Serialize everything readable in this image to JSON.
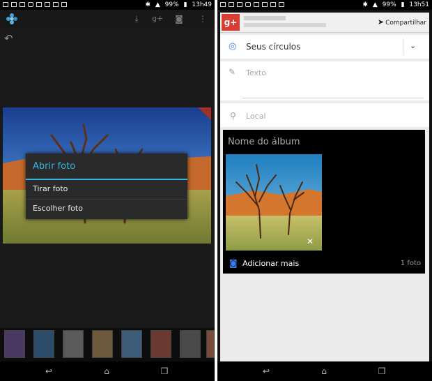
{
  "left_screen": {
    "status": {
      "battery": "99%",
      "time": "13h49"
    },
    "dialog": {
      "title": "Abrir foto",
      "options": [
        "Tirar foto",
        "Escolher foto"
      ]
    },
    "icons": [
      "app-icon",
      "download-icon",
      "gplus-icon",
      "camera-icon",
      "overflow-menu-icon",
      "back-arrow-icon"
    ]
  },
  "right_screen": {
    "status": {
      "battery": "99%",
      "time": "13h51"
    },
    "share_bar": {
      "share_label": "Compartilhar"
    },
    "audience": {
      "label": "Seus círculos"
    },
    "text_field": {
      "placeholder": "Texto"
    },
    "location_field": {
      "placeholder": "Local"
    },
    "album": {
      "name_placeholder": "Nome do álbum",
      "add_more_label": "Adicionar mais",
      "photo_count": "1 foto",
      "remove_glyph": "✕"
    },
    "gplus_logo": "g+"
  },
  "colors": {
    "accent_blue": "#33b5e5",
    "gplus_red": "#d73d32",
    "link_blue": "#3b78e7"
  }
}
